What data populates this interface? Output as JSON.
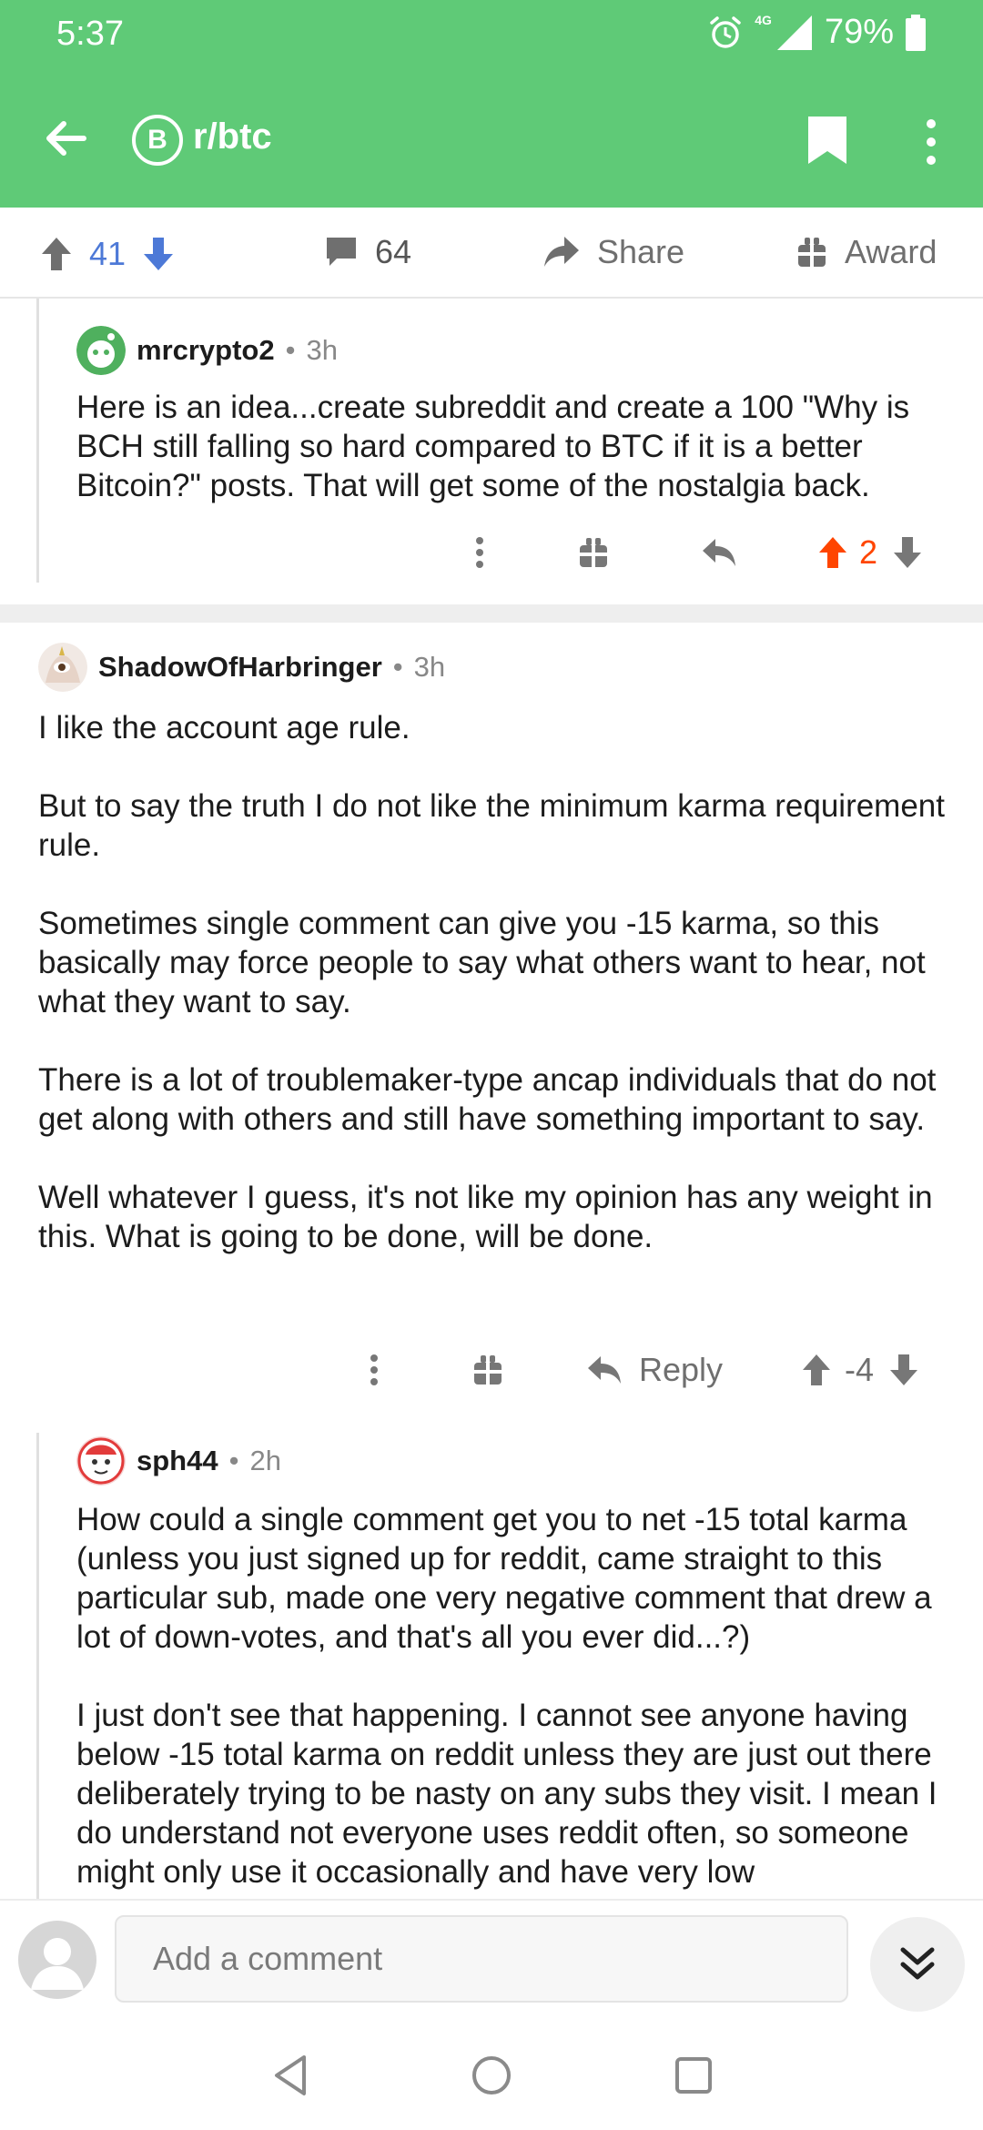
{
  "status_bar": {
    "time": "5:37",
    "network": "4G",
    "battery": "79%",
    "icons": [
      "alarm-icon",
      "signal-icon",
      "battery-icon"
    ]
  },
  "toolbar": {
    "subreddit": "r/btc",
    "subreddit_icon_glyph": "B",
    "icons": [
      "back-arrow-icon",
      "bitcoin-icon",
      "bookmark-icon",
      "more-vertical-icon"
    ]
  },
  "post_actions": {
    "score": "41",
    "comments": "64",
    "share_label": "Share",
    "award_label": "Award"
  },
  "comments": [
    {
      "author": "mrcrypto2",
      "separator": "•",
      "age": "3h",
      "paragraphs": [
        "Here is an idea...create subreddit and create a 100 \"Why is BCH still falling so hard compared to BTC if it is a better Bitcoin?\" posts.  That will get some of the nostalgia back."
      ],
      "score": "2",
      "upvoted": true
    },
    {
      "author": "ShadowOfHarbringer",
      "separator": "•",
      "age": "3h",
      "paragraphs": [
        "I like the account age rule.",
        "But to say the truth I do not like the minimum karma requirement rule.",
        "Sometimes single comment can give you -15 karma, so this basically may force people to say what others want to hear, not what they want to say.",
        "There is a lot of troublemaker-type ancap individuals that do not get along with others and still have something important to say.",
        "Well whatever I guess, it's not like my opinion has any weight in this. What is going to be done, will be done."
      ],
      "reply_label": "Reply",
      "score": "-4"
    },
    {
      "author": "sph44",
      "separator": "•",
      "age": "2h",
      "paragraphs": [
        "How could a single comment get you to net -15 total karma (unless you just signed up for reddit, came straight to this particular sub, made one very negative comment that drew a lot of down-votes, and that's all you ever did...?)",
        "I just don't see that happening.  I cannot see anyone having below -15 total karma on reddit unless they are just out there deliberately trying to be nasty on any subs they visit.  I mean I do understand not everyone uses reddit often, so someone might only use it occasionally and have very low"
      ]
    }
  ],
  "composer": {
    "placeholder": "Add a comment"
  },
  "colors": {
    "brand_green": "#5fca77",
    "upvote_orange": "#ff4500",
    "vote_blue": "#4d79d7",
    "text": "#1c1c1c",
    "muted": "#6f6f6f"
  }
}
